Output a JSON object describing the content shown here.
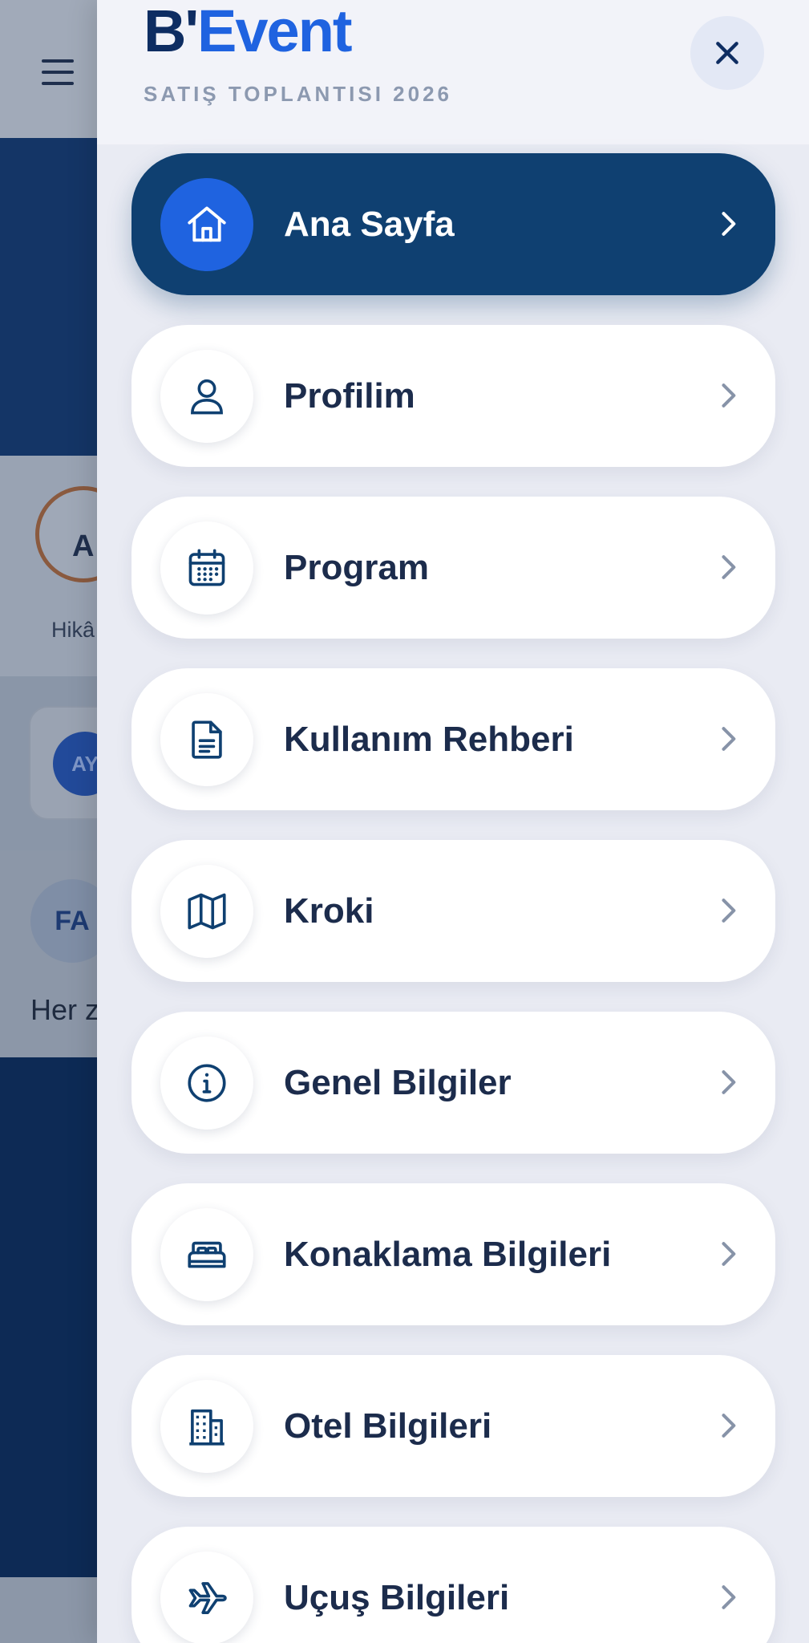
{
  "background": {
    "story_initials": "A",
    "story_label": "Hikâ",
    "card_initials": "AY",
    "feed_initials": "FA",
    "feed_text": "Her z"
  },
  "drawer": {
    "brand_part1": "B'",
    "brand_part2": "Event",
    "event_name": "SATIŞ TOPLANTISI 2026",
    "close_icon": "close-icon",
    "items": [
      {
        "label": "Ana Sayfa",
        "icon": "home-icon",
        "active": true
      },
      {
        "label": "Profilim",
        "icon": "user-icon",
        "active": false
      },
      {
        "label": "Program",
        "icon": "calendar-icon",
        "active": false
      },
      {
        "label": "Kullanım Rehberi",
        "icon": "document-icon",
        "active": false
      },
      {
        "label": "Kroki",
        "icon": "map-icon",
        "active": false
      },
      {
        "label": "Genel Bilgiler",
        "icon": "info-icon",
        "active": false
      },
      {
        "label": "Konaklama Bilgileri",
        "icon": "bed-icon",
        "active": false
      },
      {
        "label": "Otel Bilgileri",
        "icon": "building-icon",
        "active": false
      },
      {
        "label": "Uçuş Bilgileri",
        "icon": "plane-icon",
        "active": false
      }
    ]
  },
  "colors": {
    "primary_dark": "#0f4071",
    "accent_blue": "#1f63e0",
    "text_dark": "#1c2c4c",
    "drawer_bg": "#e9ebf3"
  }
}
